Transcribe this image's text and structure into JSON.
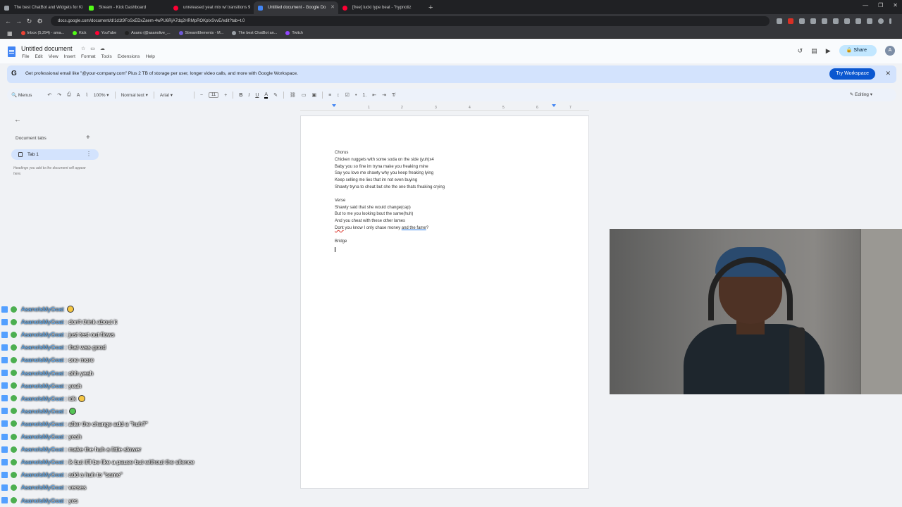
{
  "browser": {
    "tabs": [
      {
        "label": "The best ChatBot and Widgets for Ki",
        "color": "#9aa0a6",
        "active": false
      },
      {
        "label": "Stream - Kick Dashboard",
        "color": "#53fc18",
        "active": false
      },
      {
        "label": "unreleased yeat mix w/ transitions 9",
        "color": "#ff0033",
        "active": false
      },
      {
        "label": "Untitled document - Google Do",
        "color": "#4285f4",
        "active": true
      },
      {
        "label": "[free] lucki type beat - \"hypnotiz",
        "color": "#ff0033",
        "active": false
      }
    ],
    "url": "docs.google.com/document/d/1d1t9FoSxEDxZaem-4wPU6RjA7dq2HRMpROKpIxSvvE/edit?tab=t.0",
    "bookmarks": [
      {
        "label": "Inbox (5,294) - ama...",
        "color": "#ea4335"
      },
      {
        "label": "Kick",
        "color": "#53fc18"
      },
      {
        "label": "YouTube",
        "color": "#ff0033"
      },
      {
        "label": "Asano (@asanolive_...",
        "color": "#222222"
      },
      {
        "label": "StreamElements - M...",
        "color": "#6f5bd8"
      },
      {
        "label": "The best ChatBot an...",
        "color": "#9aa0a6"
      },
      {
        "label": "Twitch",
        "color": "#9146ff"
      }
    ]
  },
  "docs": {
    "title": "Untitled document",
    "menu": [
      "File",
      "Edit",
      "View",
      "Insert",
      "Format",
      "Tools",
      "Extensions",
      "Help"
    ],
    "share_label": "Share",
    "avatar_initial": "A",
    "banner": {
      "g": "G",
      "message": "Get professional email like \"@your-company.com\" Plus 2 TB of storage per user, longer video calls, and more with Google Workspace.",
      "try_label": "Try Workspace"
    },
    "toolbar": {
      "menus_label": "Menus",
      "zoom": "100%",
      "style": "Normal text",
      "font": "Arial",
      "font_size": "11",
      "editing": "Editing"
    },
    "ruler_marks": [
      "1",
      "2",
      "3",
      "4",
      "5",
      "6",
      "7"
    ],
    "sidebar": {
      "heading": "Document tabs",
      "tab1": "Tab 1",
      "hint": "Headings you add to the document will appear here."
    },
    "lines": {
      "l1": "Chorus",
      "l2": "Chicken nuggets with some soda on the side (yuh)x4",
      "l3": "Baby you so fine im tryna make you freaking mine",
      "l4": "Say you love me shawty why you keep freaking lying",
      "l5": "Keep selling me lies that im not even buying",
      "l6": "Shawty tryna  to cheat but she the one thats freaking crying",
      "l7": " Verse",
      "l8": "Shawty said that she would change(cap)",
      "l9": "But to me you looking bout the same(huh)",
      "l10": "And you cheat with these other lames",
      "l11a": "Dont",
      "l11b": " you know I only chase money ",
      "l11c": "and the fame",
      "l11d": "?",
      "l12": "Bridge"
    }
  },
  "chat": {
    "username": "AsanoIsMyGoat",
    "messages": [
      {
        "text": "",
        "emoji": "yellow",
        "partial": true
      },
      {
        "text": ": don't think about it",
        "emoji": ""
      },
      {
        "text": ": just test out flows",
        "emoji": ""
      },
      {
        "text": ": that was good",
        "emoji": ""
      },
      {
        "text": ": one more",
        "emoji": ""
      },
      {
        "text": ": ohh yeah",
        "emoji": ""
      },
      {
        "text": ": yeah",
        "emoji": ""
      },
      {
        "text": ": idk",
        "emoji": "yellow"
      },
      {
        "text": ":",
        "emoji": "green"
      },
      {
        "text": ": after the change add a \"huh?\"",
        "emoji": ""
      },
      {
        "text": ": yeah",
        "emoji": ""
      },
      {
        "text": ": make the huh a little slower",
        "emoji": ""
      },
      {
        "text": ": ik but it'll be like a pause but without the silence",
        "emoji": ""
      },
      {
        "text": ": add a huh to \"same\"",
        "emoji": ""
      },
      {
        "text": ": verses",
        "emoji": ""
      },
      {
        "text": ": yes",
        "emoji": ""
      }
    ]
  }
}
